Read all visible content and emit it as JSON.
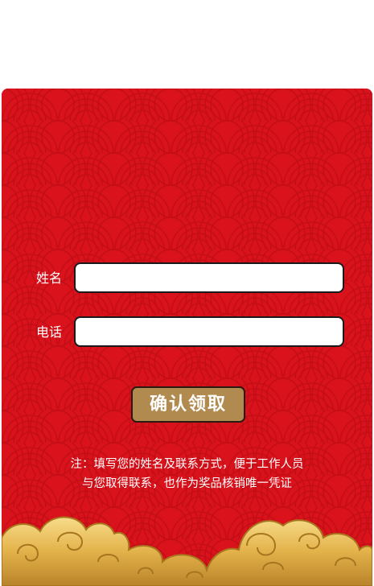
{
  "form": {
    "name_label": "姓名",
    "name_value": "",
    "phone_label": "电话",
    "phone_value": "",
    "confirm_label": "确认领取"
  },
  "note": {
    "line1": "注：填写您的姓名及联系方式，便于工作人员",
    "line2": "与您取得联系，也作为奖品核销唯一凭证"
  },
  "colors": {
    "background_red": "#d9121b",
    "button_gold": "#b08a4f",
    "cloud_gold": "#e8c15a"
  },
  "icons": {
    "decoration": "auspicious-clouds",
    "background": "wave-scale-pattern"
  }
}
